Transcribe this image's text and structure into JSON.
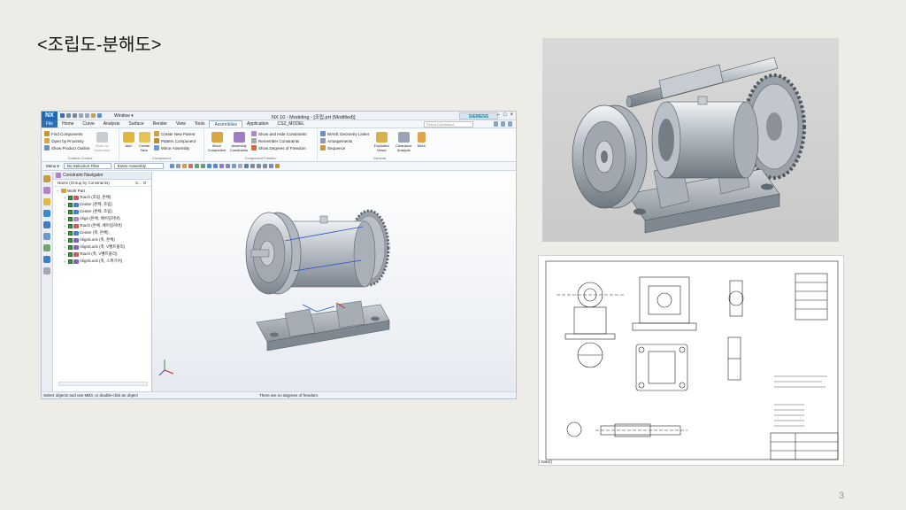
{
  "slide": {
    "title": "<조립도-분해도>",
    "page_number": "3"
  },
  "nx": {
    "logo": "NX",
    "window_menu": "Window ▾",
    "title": "NX 10 - Modeling - [조립.prt (Modified)]",
    "brand": "SIEMENS",
    "search_placeholder": "Find a Command",
    "tabs": [
      "File",
      "Home",
      "Curve",
      "Analysis",
      "Surface",
      "Render",
      "View",
      "Tools",
      "Assemblies",
      "Application",
      "CSZ_MODEL"
    ],
    "active_tab": "Assemblies",
    "ribbon": {
      "context_control": {
        "items": [
          "Find Components",
          "Open by Proximity",
          "Show Product Outline"
        ],
        "work_on": "Work on Assembly",
        "label": "Context Control"
      },
      "component": {
        "add": "Add",
        "create_new": "Create New",
        "items": [
          "Create New Parent",
          "Pattern Component",
          "Mirror Assembly"
        ],
        "label": "Component"
      },
      "component_position": {
        "move": "Move Component",
        "constraints": "Assembly Constraints",
        "items": [
          "Show and Hide Constraints",
          "Remember Constraints",
          "Show Degrees of Freedom"
        ],
        "label": "Component Position"
      },
      "general": {
        "items": [
          "WAVE Geometry Linker",
          "Arrangements",
          "Sequence"
        ],
        "exploded": "Exploded Views",
        "clearance": "Clearance Analysis",
        "more": "More",
        "label": "General"
      }
    },
    "toolbar": {
      "menu": "Menu ▾",
      "selection_filter": "No Selection Filter",
      "assembly_scope": "Entire Assembly"
    },
    "navigator": {
      "title": "Constraint Navigator",
      "column_name": "Name (Group by Constraints)",
      "column_s": "S...",
      "column_d": "D",
      "root": "Work Part",
      "items": [
        "Touch (조립, 본체)",
        "Center (본체, 조립)",
        "Center (본체, 조립)",
        "Align (본체, 베어링커버)",
        "Touch (본체, 베어링커버)",
        "Center (축, 본체)",
        "Align/Lock (축, 본체)",
        "Align/Lock (축, V벨트풀리)",
        "Touch (축, V벨트풀리)",
        "Align/Lock (축, 스퍼기어)"
      ]
    },
    "status": {
      "left": "Select objects and use MB3, or double-click an object",
      "center": "There are no degrees of freedom."
    }
  },
  "drawing": {
    "date_label": "f Date()"
  },
  "colors": {
    "background": "#edece6",
    "nx_blue": "#2e6fb4",
    "check_green": "#2e9d3a",
    "model_grey": "#b8bfc6"
  }
}
